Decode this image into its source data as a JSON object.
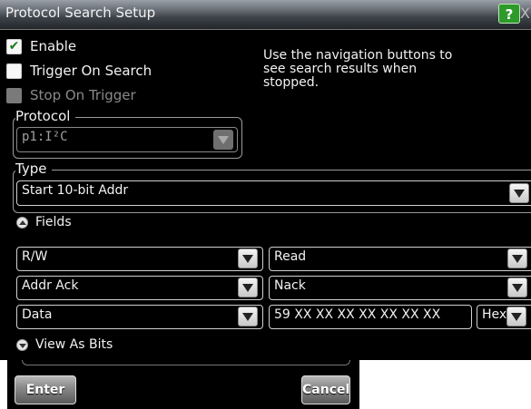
{
  "dialog": {
    "title": "Protocol Search Setup",
    "help_label": "?",
    "close_label": "X"
  },
  "options": {
    "enable": {
      "label": "Enable",
      "checked": true
    },
    "trigger_on_search": {
      "label": "Trigger On Search",
      "checked": false
    },
    "stop_on_trigger": {
      "label": "Stop On Trigger",
      "checked": false,
      "disabled": true
    }
  },
  "info_text": "Use the navigation buttons to see search results when stopped.",
  "protocol": {
    "label": "Protocol",
    "value": "p1:I²C"
  },
  "type": {
    "label": "Type",
    "value": "Start 10-bit Addr"
  },
  "fields": {
    "label": "Fields",
    "rows": [
      {
        "field": "R/W",
        "value": "Read"
      },
      {
        "field": "Addr Ack",
        "value": "Nack"
      },
      {
        "field": "Data",
        "value": "59 XX XX XX XX XX XX XX",
        "format": "Hex"
      }
    ]
  },
  "view_as_bits": {
    "label": "View As Bits"
  },
  "buttons": {
    "enter": "Enter",
    "cancel": "Cancel"
  },
  "icons": {
    "check": "✔",
    "expand_up": "collapse-icon",
    "expand_down": "expand-icon",
    "dropdown": "chevron-down-icon"
  }
}
